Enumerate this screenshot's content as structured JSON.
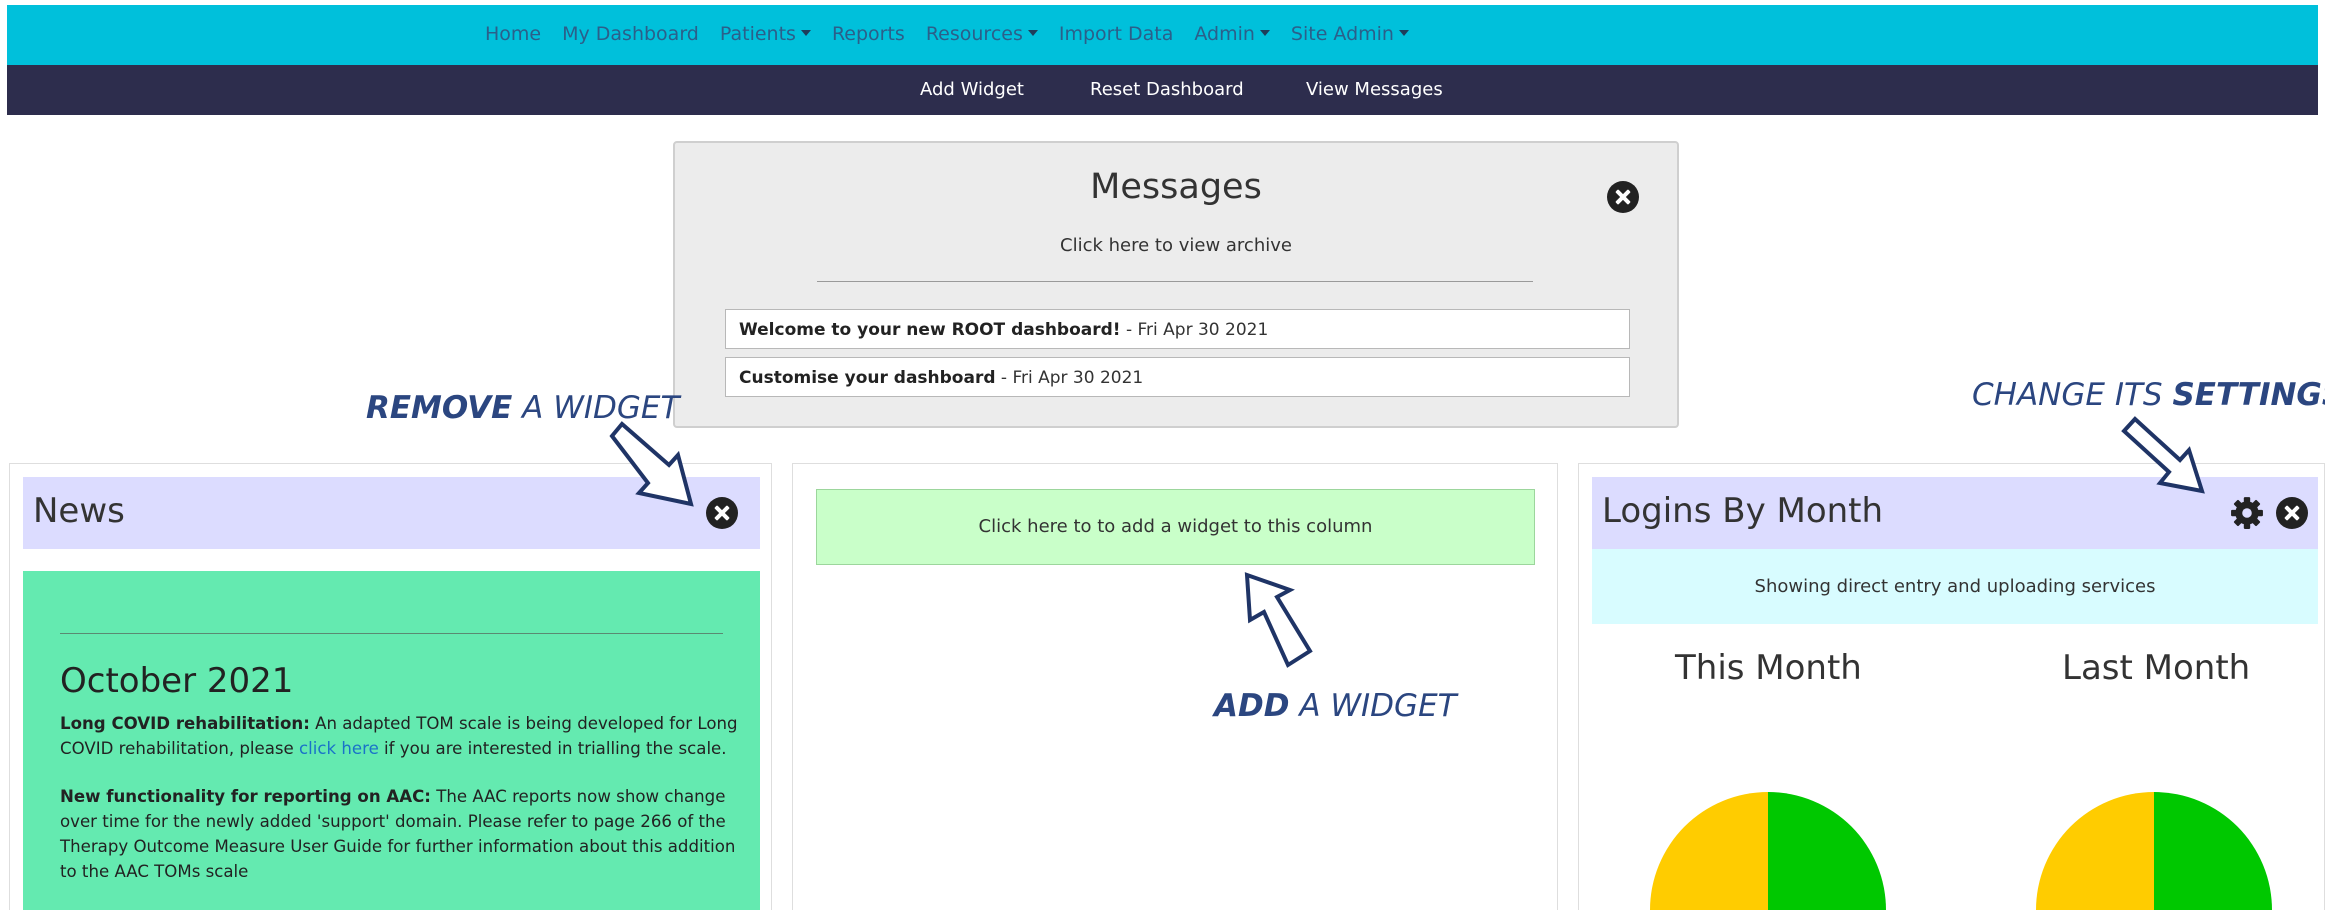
{
  "topnav": {
    "items": [
      {
        "label": "Home",
        "caret": false
      },
      {
        "label": "My Dashboard",
        "caret": false
      },
      {
        "label": "Patients",
        "caret": true
      },
      {
        "label": "Reports",
        "caret": false
      },
      {
        "label": "Resources",
        "caret": true
      },
      {
        "label": "Import Data",
        "caret": false
      },
      {
        "label": "Admin",
        "caret": true
      },
      {
        "label": "Site Admin",
        "caret": true
      }
    ]
  },
  "subnav": {
    "add_widget": "Add Widget",
    "reset_dashboard": "Reset Dashboard",
    "view_messages": "View Messages"
  },
  "messages": {
    "title": "Messages",
    "archive": "Click here to view archive",
    "items": [
      {
        "subject": "Welcome to your new ROOT dashboard!",
        "date": " - Fri Apr 30 2021"
      },
      {
        "subject": "Customise your dashboard",
        "date": " - Fri Apr 30 2021"
      }
    ]
  },
  "news": {
    "title": "News",
    "heading": "October 2021",
    "p1_bold": "Long COVID rehabilitation:",
    "p1_text_a": " An adapted TOM scale is being developed for Long COVID rehabilitation, please ",
    "p1_link": "click here",
    "p1_text_b": " if you are interested in trialling the scale.",
    "p2_bold": "New functionality for reporting on AAC:",
    "p2_text": "  The AAC reports now show change over time for the newly added 'support' domain. Please refer to page 266 of the Therapy Outcome Measure User Guide for further information about this addition to the AAC TOMs scale"
  },
  "middle": {
    "add_prompt": "Click here to to add a widget to this column"
  },
  "logins": {
    "title": "Logins By Month",
    "subtitle": "Showing direct entry and uploading services",
    "this_month": "This Month",
    "last_month": "Last Month",
    "colors": {
      "green": "#00c800",
      "yellow": "#ffcc00"
    }
  },
  "annotations": {
    "remove_bold": "REMOVE",
    "remove_rest": " A WIDGET",
    "add_bold": "ADD",
    "add_rest": " A WIDGET",
    "settings_prefix": "CHANGE ITS ",
    "settings_bold": "SETTINGS"
  },
  "icons": [
    "close-circle-icon",
    "gear-icon",
    "caret-down-icon",
    "outline-arrow-icon"
  ]
}
